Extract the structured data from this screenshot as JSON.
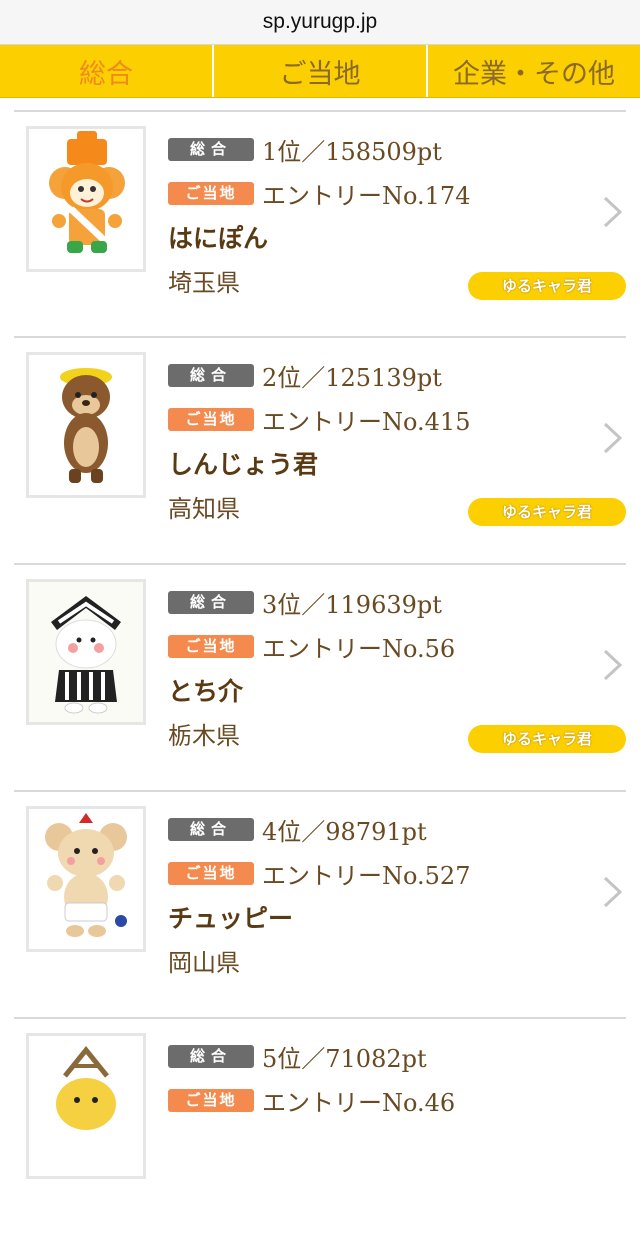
{
  "browser": {
    "url": "sp.yurugp.jp"
  },
  "tabs": [
    {
      "label": "総合",
      "active": true
    },
    {
      "label": "ご当地",
      "active": false
    },
    {
      "label": "企業・その他",
      "active": false
    }
  ],
  "labels": {
    "overall_badge": "総合",
    "local_badge": "ご当地",
    "yuru_badge": "ゆるキャラ君"
  },
  "colors": {
    "tab_bar": "#fcd000",
    "active_tab": "#f08a1a",
    "local_badge": "#f58a4e",
    "overall_badge": "#6c6c6c"
  },
  "entries": [
    {
      "rank_text": "1位／158509pt",
      "entry_text": "エントリーNo.174",
      "name": "はにぽん",
      "prefecture": "埼玉県",
      "has_yuru_badge": true,
      "icon": "haniponn-mascot-image"
    },
    {
      "rank_text": "2位／125139pt",
      "entry_text": "エントリーNo.415",
      "name": "しんじょう君",
      "prefecture": "高知県",
      "has_yuru_badge": true,
      "icon": "shinjo-kun-mascot-image"
    },
    {
      "rank_text": "3位／119639pt",
      "entry_text": "エントリーNo.56",
      "name": "とち介",
      "prefecture": "栃木県",
      "has_yuru_badge": true,
      "icon": "tochisuke-mascot-image"
    },
    {
      "rank_text": "4位／98791pt",
      "entry_text": "エントリーNo.527",
      "name": "チュッピー",
      "prefecture": "岡山県",
      "has_yuru_badge": false,
      "icon": "chuppy-mascot-image"
    },
    {
      "rank_text": "5位／71082pt",
      "entry_text": "エントリーNo.46",
      "name": "",
      "prefecture": "",
      "has_yuru_badge": false,
      "icon": "mascot-5-image"
    }
  ]
}
